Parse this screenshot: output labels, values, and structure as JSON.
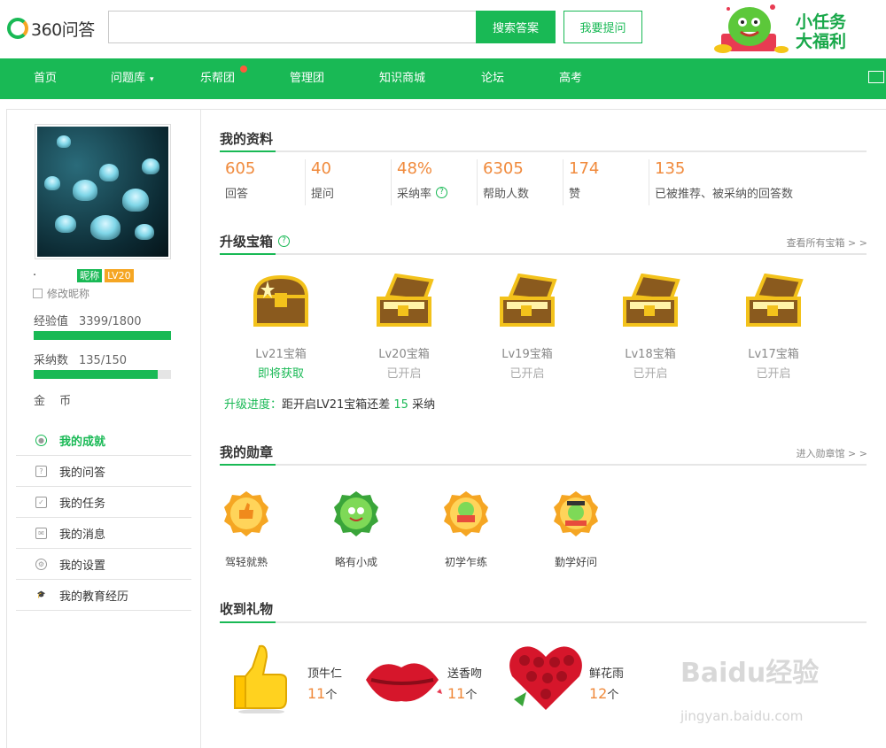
{
  "header": {
    "logo_text": "360问答",
    "search_button": "搜索答案",
    "ask_button": "我要提问",
    "promo_line1": "小任务",
    "promo_line2": "大福利"
  },
  "nav": {
    "items": [
      "首页",
      "问题库",
      "乐帮团",
      "管理团",
      "知识商城",
      "论坛",
      "高考"
    ]
  },
  "profile": {
    "nickname_prefix": "·",
    "nickname_badge": "昵称",
    "level_badge": "LV20",
    "edit_nickname": "修改昵称",
    "exp_label": "经验值",
    "exp_value": "3399/1800",
    "exp_fill": 1.0,
    "adopt_label": "采纳数",
    "adopt_value": "135/150",
    "adopt_fill": 0.9,
    "coin_label": "金 币"
  },
  "menu": {
    "items": [
      "我的成就",
      "我的问答",
      "我的任务",
      "我的消息",
      "我的设置",
      "我的教育经历"
    ]
  },
  "my_info": {
    "title": "我的资料",
    "stats": [
      {
        "value": "605",
        "label": "回答"
      },
      {
        "value": "40",
        "label": "提问"
      },
      {
        "value": "48%",
        "label": "采纳率"
      },
      {
        "value": "6305",
        "label": "帮助人数"
      },
      {
        "value": "174",
        "label": "赞"
      },
      {
        "value": "135",
        "label": "已被推荐、被采纳的回答数"
      }
    ]
  },
  "chests": {
    "title": "升级宝箱",
    "more": "查看所有宝箱 > >",
    "items": [
      {
        "name": "Lv21宝箱",
        "status": "即将获取"
      },
      {
        "name": "Lv20宝箱",
        "status": "已开启"
      },
      {
        "name": "Lv19宝箱",
        "status": "已开启"
      },
      {
        "name": "Lv18宝箱",
        "status": "已开启"
      },
      {
        "name": "Lv17宝箱",
        "status": "已开启"
      }
    ],
    "progress_label": "升级进度：",
    "progress_text": "距开启LV21宝箱还差",
    "progress_num": "15",
    "progress_unit": "采纳"
  },
  "medals": {
    "title": "我的勋章",
    "more": "进入勋章馆 > >",
    "items": [
      "驾轻就熟",
      "略有小成",
      "初学乍练",
      "勤学好问"
    ]
  },
  "gifts": {
    "title": "收到礼物",
    "items": [
      {
        "name": "顶牛仁",
        "count": "11",
        "unit": "个"
      },
      {
        "name": "送香吻",
        "count": "11",
        "unit": "个"
      },
      {
        "name": "鲜花雨",
        "count": "12",
        "unit": "个"
      }
    ]
  },
  "watermark": {
    "line1": "Baidu经验",
    "line2": "jingyan.baidu.com"
  },
  "colors": {
    "brand_green": "#19b955",
    "accent_orange": "#f08a3c"
  }
}
